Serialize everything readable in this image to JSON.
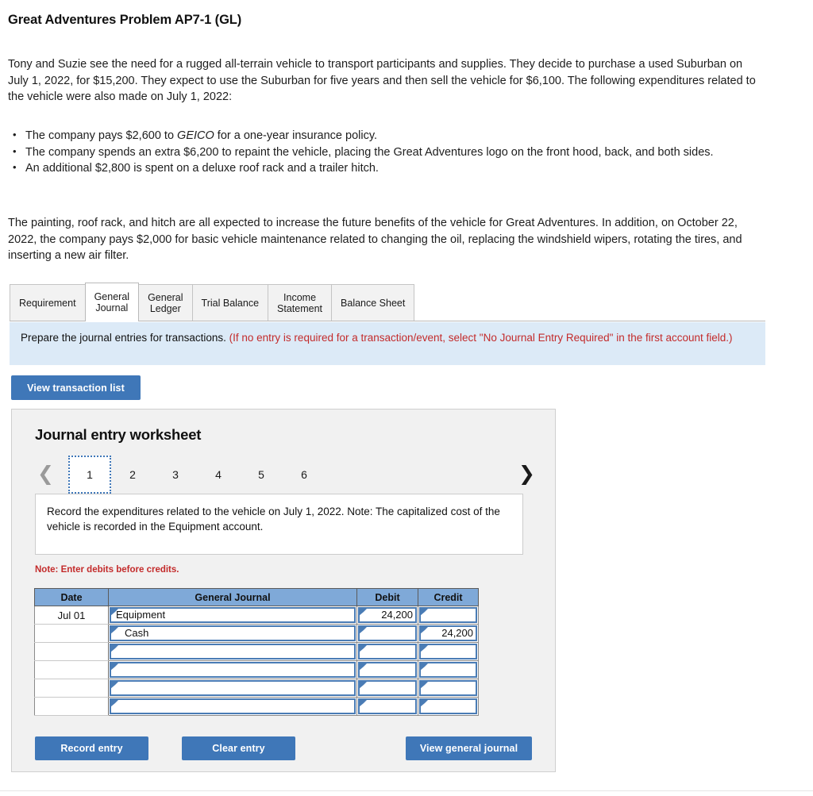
{
  "problem": {
    "title": "Great Adventures Problem AP7-1 (GL)",
    "intro": "Tony and Suzie see the need for a rugged all-terrain vehicle to transport participants and supplies. They decide to purchase a used Suburban on July 1, 2022, for $15,200. They expect to use the Suburban for five years and then sell the vehicle for $6,100. The following expenditures related to the vehicle were also made on July 1, 2022:",
    "bullets": [
      {
        "before": "The company pays $2,600 to ",
        "italic": "GEICO",
        "after": " for a one-year insurance policy."
      },
      {
        "before": "The company spends an extra $6,200 to repaint the vehicle, placing the Great Adventures logo on the front hood, back, and both sides.",
        "italic": "",
        "after": ""
      },
      {
        "before": "An additional $2,800 is spent on a deluxe roof rack and a trailer hitch.",
        "italic": "",
        "after": ""
      }
    ],
    "closing": "The painting, roof rack, and hitch are all expected to increase the future benefits of the vehicle for Great Adventures. In addition, on October 22, 2022, the company pays $2,000 for basic vehicle maintenance related to changing the oil, replacing the windshield wipers, rotating the tires, and inserting a new air filter."
  },
  "tabs": [
    {
      "label": "Requirement",
      "active": false
    },
    {
      "label": "General\nJournal",
      "active": true
    },
    {
      "label": "General\nLedger",
      "active": false
    },
    {
      "label": "Trial Balance",
      "active": false
    },
    {
      "label": "Income\nStatement",
      "active": false
    },
    {
      "label": "Balance Sheet",
      "active": false
    }
  ],
  "banner": {
    "main": "Prepare the journal entries for transactions.",
    "hint": "(If no entry is required for a transaction/event, select \"No Journal Entry Required\" in the first account field.)"
  },
  "buttons": {
    "view_transaction_list": "View transaction list",
    "record_entry": "Record entry",
    "clear_entry": "Clear entry",
    "view_general_journal": "View general journal"
  },
  "worksheet": {
    "title": "Journal entry worksheet",
    "pager": {
      "prev_icon": "chevron-left",
      "next_icon": "chevron-right",
      "pages": [
        "1",
        "2",
        "3",
        "4",
        "5",
        "6"
      ],
      "active_page": "1"
    },
    "instruction": "Record the expenditures related to the vehicle on July 1, 2022. Note: The capitalized cost of the vehicle is recorded in the Equipment account.",
    "note": "Note: Enter debits before credits.",
    "table": {
      "headers": [
        "Date",
        "General Journal",
        "Debit",
        "Credit"
      ],
      "rows": [
        {
          "date": "Jul 01",
          "account": "Equipment",
          "indent": false,
          "debit": "24,200",
          "credit": ""
        },
        {
          "date": "",
          "account": "Cash",
          "indent": true,
          "debit": "",
          "credit": "24,200"
        },
        {
          "date": "",
          "account": "",
          "indent": false,
          "debit": "",
          "credit": ""
        },
        {
          "date": "",
          "account": "",
          "indent": false,
          "debit": "",
          "credit": ""
        },
        {
          "date": "",
          "account": "",
          "indent": false,
          "debit": "",
          "credit": ""
        },
        {
          "date": "",
          "account": "",
          "indent": false,
          "debit": "",
          "credit": ""
        }
      ]
    }
  },
  "colors": {
    "accent_blue": "#3f77b8",
    "table_header_blue": "#7fa9d8",
    "banner_blue": "#dceaf7",
    "red_note": "#c32b2b",
    "cell_border_blue": "#4a7cb5"
  }
}
